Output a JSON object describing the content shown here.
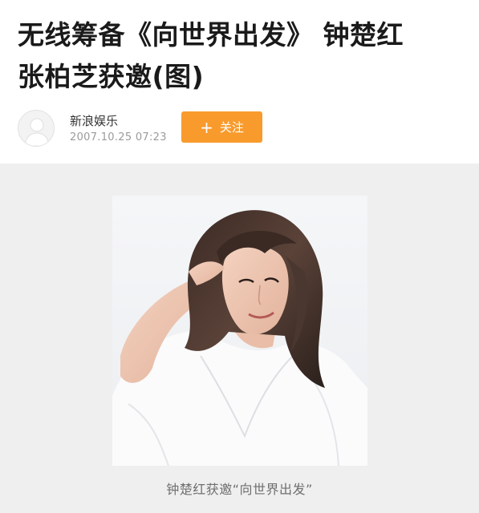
{
  "article": {
    "title_line1": "无线筹备《向世界出发》 钟楚红",
    "title_line2": "张柏芝获邀(图)"
  },
  "author": {
    "name": "新浪娱乐",
    "publish_time": "2007.10.25  07:23",
    "avatar_icon": "default-user-avatar-icon"
  },
  "follow": {
    "plus": "+",
    "label": "关注",
    "color": "#f89b2c"
  },
  "photo": {
    "caption": "钟楚红获邀“向世界出发”"
  }
}
